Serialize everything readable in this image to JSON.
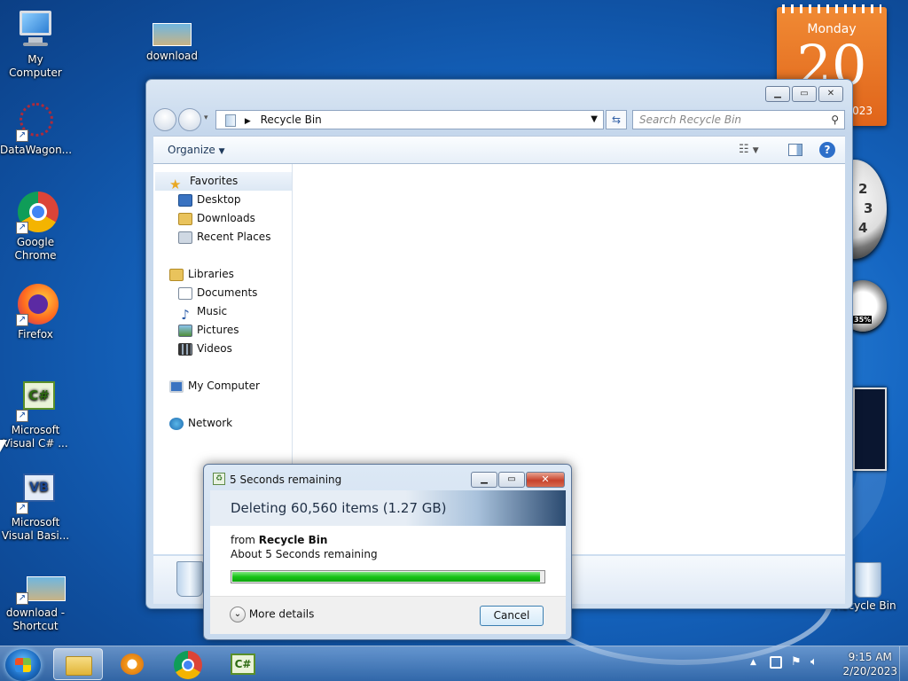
{
  "desktop_icons": [
    {
      "id": "my-computer",
      "label": "My Computer"
    },
    {
      "id": "download",
      "label": "download"
    },
    {
      "id": "datawagon",
      "label": "DataWagon..."
    },
    {
      "id": "chrome",
      "label": "Google Chrome"
    },
    {
      "id": "firefox",
      "label": "Firefox"
    },
    {
      "id": "vcsharp",
      "label": "Microsoft Visual C# ..."
    },
    {
      "id": "vbasic",
      "label": "Microsoft Visual Basi..."
    },
    {
      "id": "download-shortcut",
      "label": "download - Shortcut"
    },
    {
      "id": "recycle-bin",
      "label": "Recycle Bin"
    }
  ],
  "calendar": {
    "day": "Monday",
    "date": "20",
    "month_year": "2023"
  },
  "clock_numbers": [
    "2",
    "3",
    "4"
  ],
  "meter": {
    "value": "35%"
  },
  "explorer": {
    "address": "Recycle Bin",
    "search_placeholder": "Search Recycle Bin",
    "organize": "Organize",
    "nav": {
      "favorites": "Favorites",
      "desktop": "Desktop",
      "downloads": "Downloads",
      "recent": "Recent Places",
      "libraries": "Libraries",
      "documents": "Documents",
      "music": "Music",
      "pictures": "Pictures",
      "videos": "Videos",
      "computer": "My Computer",
      "network": "Network"
    }
  },
  "dialog": {
    "title": "5 Seconds remaining",
    "heading": "Deleting 60,560 items (1.27 GB)",
    "from_prefix": "from",
    "from_location": "Recycle Bin",
    "remaining": "About 5 Seconds remaining",
    "progress": 0.99,
    "more_details": "More details",
    "cancel": "Cancel"
  },
  "tray": {
    "time": "9:15 AM",
    "date": "2/20/2023"
  },
  "colors": {
    "accent": "#1566c2",
    "progress": "#17c417",
    "calendar": "#e86e22"
  }
}
